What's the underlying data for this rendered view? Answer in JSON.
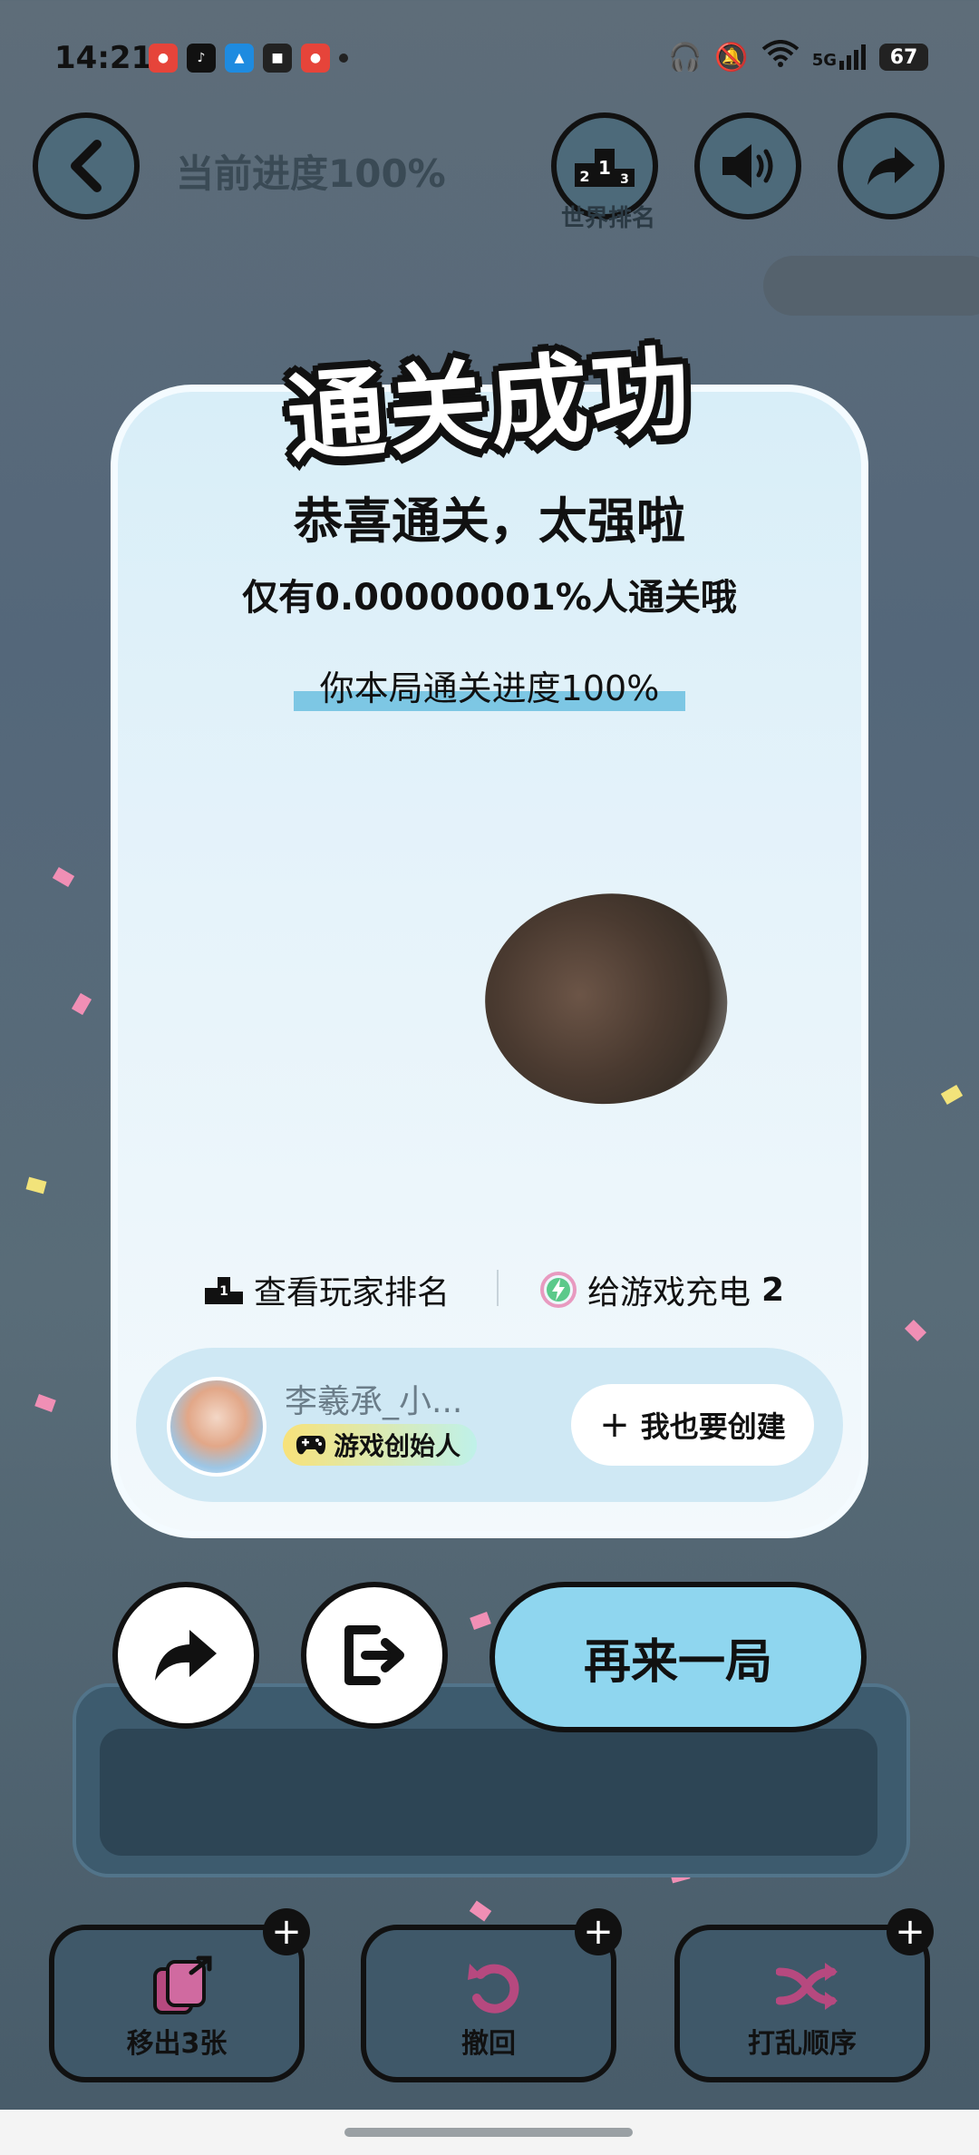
{
  "status_bar": {
    "time": "14:21",
    "battery": "67",
    "network": "5G"
  },
  "header": {
    "progress_label": "当前进度100%",
    "world_rank_caption": "世界排名",
    "icons": [
      "back-arrow-icon",
      "podium-icon",
      "speaker-icon",
      "share-arrow-icon"
    ]
  },
  "result": {
    "banner": "通关成功",
    "congrats": "恭喜通关，太强啦",
    "rarity": "仅有0.00000001%人通关哦",
    "round_progress": "你本局通关进度100%"
  },
  "links": {
    "player_rank": "查看玩家排名",
    "charge_game": "给游戏充电",
    "charge_count": "2"
  },
  "creator": {
    "name": "李羲承_小...",
    "badge": "游戏创始人",
    "create_button": "我也要创建"
  },
  "actions": {
    "replay": "再来一局"
  },
  "tools": [
    {
      "label": "移出3张",
      "icon": "card-out-icon"
    },
    {
      "label": "撤回",
      "icon": "undo-icon"
    },
    {
      "label": "打乱顺序",
      "icon": "shuffle-icon"
    }
  ],
  "colors": {
    "accent_blue": "#8fd6ef",
    "card_bg": "#e6f3fa",
    "confetti_pink": "#f08fb5",
    "confetti_yellow": "#f2e37a"
  }
}
